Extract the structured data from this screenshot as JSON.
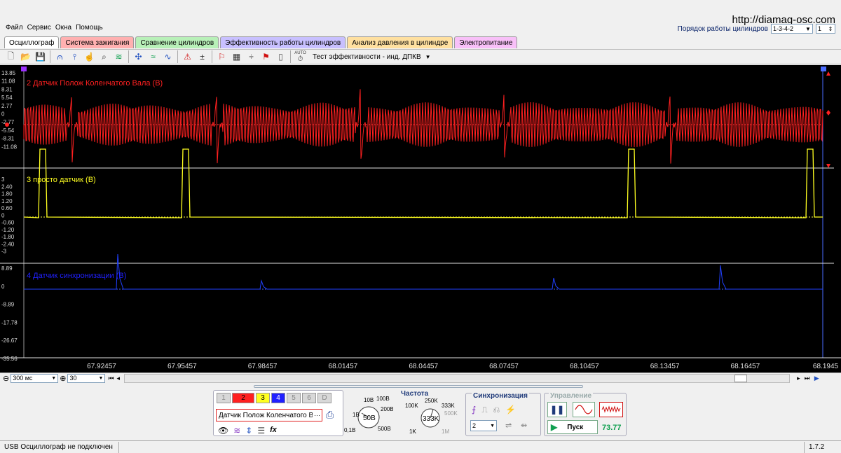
{
  "menu": [
    "Файл",
    "Сервис",
    "Окна",
    "Помощь"
  ],
  "watermark": "http://diamag-osc.com",
  "firing_order": {
    "label": "Порядок работы цилиндров",
    "value": "1-3-4-2",
    "spin": "1"
  },
  "tabs": [
    {
      "label": "Осциллограф",
      "bg": "#ffffff"
    },
    {
      "label": "Система зажигания",
      "bg": "#ffb0b0"
    },
    {
      "label": "Сравнение цилиндров",
      "bg": "#b8f0b8"
    },
    {
      "label": "Эффективность работы цилиндров",
      "bg": "#c8c0ff"
    },
    {
      "label": "Анализ давления в цилиндре",
      "bg": "#ffe0a0"
    },
    {
      "label": "Электропитание",
      "bg": "#f8c0f8"
    }
  ],
  "toolbar": {
    "mode_label": "Тест эффективности - инд. ДПКВ",
    "auto_label": "AUTO"
  },
  "channels": [
    {
      "title": "2 Датчик Полож Коленчатого Вала (В)",
      "color": "#ff2020",
      "ticks": [
        "13.85",
        "11.08",
        "8.31",
        "5.54",
        "2.77",
        "0",
        "-2.77",
        "-5.54",
        "-8.31",
        "-11.08"
      ]
    },
    {
      "title": "3 просто датчик (В)",
      "color": "#ffff20",
      "ticks": [
        "3",
        "2.40",
        "1.80",
        "1.20",
        "0.60",
        "0",
        "-0.60",
        "-1.20",
        "-1.80",
        "-2.40",
        "-3"
      ]
    },
    {
      "title": "4 Датчик синхронизации (В)",
      "color": "#2020ff",
      "ticks": [
        "8.89",
        "0",
        "-8.89",
        "-17.78",
        "-26.67",
        "-35.56"
      ]
    }
  ],
  "time_axis": [
    "67.92457",
    "67.95457",
    "67.98457",
    "68.01457",
    "68.04457",
    "68.07457",
    "68.10457",
    "68.13457",
    "68.16457",
    "68.1945"
  ],
  "scroll": {
    "timebase": "300 мс",
    "count": "30"
  },
  "channel_buttons": [
    {
      "label": "1",
      "bg": "#d8d8d8",
      "fg": "#888"
    },
    {
      "label": "2",
      "bg": "#ff2020",
      "fg": "#000"
    },
    {
      "label": "3",
      "bg": "#ffff20",
      "fg": "#000"
    },
    {
      "label": "4",
      "bg": "#2020ff",
      "fg": "#fff"
    },
    {
      "label": "5",
      "bg": "#d8d8d8",
      "fg": "#888"
    },
    {
      "label": "6",
      "bg": "#d8d8d8",
      "fg": "#888"
    },
    {
      "label": "D",
      "bg": "#d8d8d8",
      "fg": "#888"
    }
  ],
  "channel_select": "Датчик Полож Коленчатого Ва",
  "volt_knob": {
    "labels": [
      "10В",
      "100В",
      "200В",
      "500В",
      "0,1В",
      "1В"
    ],
    "value": "50В"
  },
  "freq": {
    "title": "Частота",
    "labels": [
      "250K",
      "100K",
      "333K",
      "500K",
      "1M",
      "1K"
    ],
    "value": "333K"
  },
  "sync": {
    "title": "Синхронизация",
    "value": "2"
  },
  "control": {
    "title": "Управление",
    "start_label": "Пуск",
    "value": "73.77"
  },
  "status": {
    "message": "USB Осциллограф не подключен",
    "version": "1.7.2"
  }
}
